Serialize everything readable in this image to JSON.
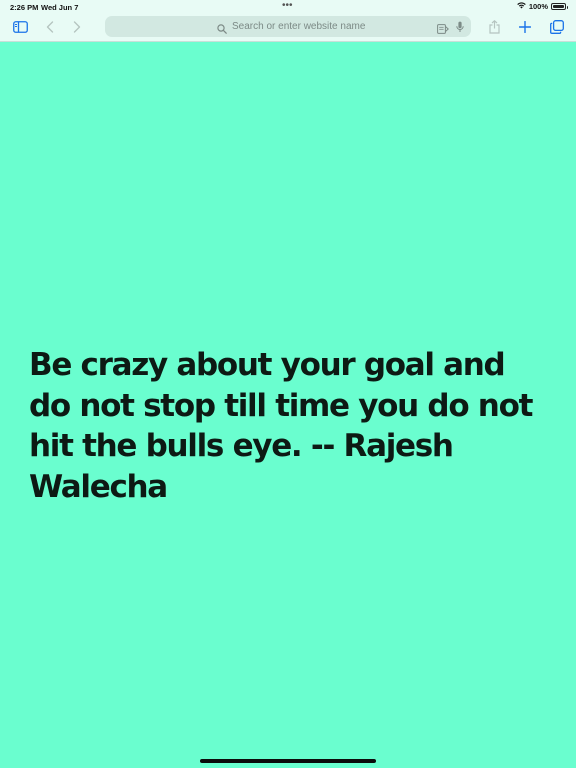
{
  "status_bar": {
    "time": "2:26 PM",
    "date": "Wed Jun 7",
    "battery": "100%",
    "multitask_dots": "•••"
  },
  "toolbar": {
    "address_placeholder": "Search or enter website name",
    "icons": [
      "sidebar-icon",
      "back-icon",
      "forward-icon",
      "search-icon",
      "reader-icon",
      "microphone-icon",
      "share-icon",
      "new-tab-icon",
      "tabs-overview-icon"
    ]
  },
  "page": {
    "quote": "Be crazy about your goal and do not stop till time you do not hit the bulls eye. -- Rajesh Walecha",
    "background_color": "#6afecf"
  }
}
